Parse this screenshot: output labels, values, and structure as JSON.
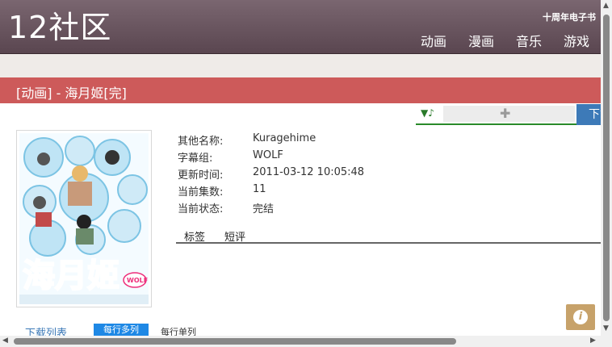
{
  "header": {
    "logo": "12社区",
    "ebook": "十周年电子书",
    "nav": [
      "动画",
      "漫画",
      "音乐",
      "游戏"
    ]
  },
  "title": "[动画] - 海月姬[完]",
  "player": {
    "note_icon": "♪",
    "download_label": "下载"
  },
  "info": [
    {
      "key": "其他名称:",
      "value": "Kuragehime"
    },
    {
      "key": "字幕组:",
      "value": "WOLF"
    },
    {
      "key": "更新时间:",
      "value": "2011-03-12 10:05:48"
    },
    {
      "key": "当前集数:",
      "value": "11"
    },
    {
      "key": "当前状态:",
      "value": "完结"
    }
  ],
  "tabs": [
    "标签",
    "短评"
  ],
  "cover": {
    "title_art": "海月姬",
    "badge": "WOLF"
  },
  "download_list": {
    "title": "下载列表",
    "mode_multi": "每行多列",
    "mode_single": "每行单列"
  },
  "colors": {
    "title_bar": "#cd5a5a",
    "header": "#6a5660",
    "accent": "#3d7ab8"
  }
}
